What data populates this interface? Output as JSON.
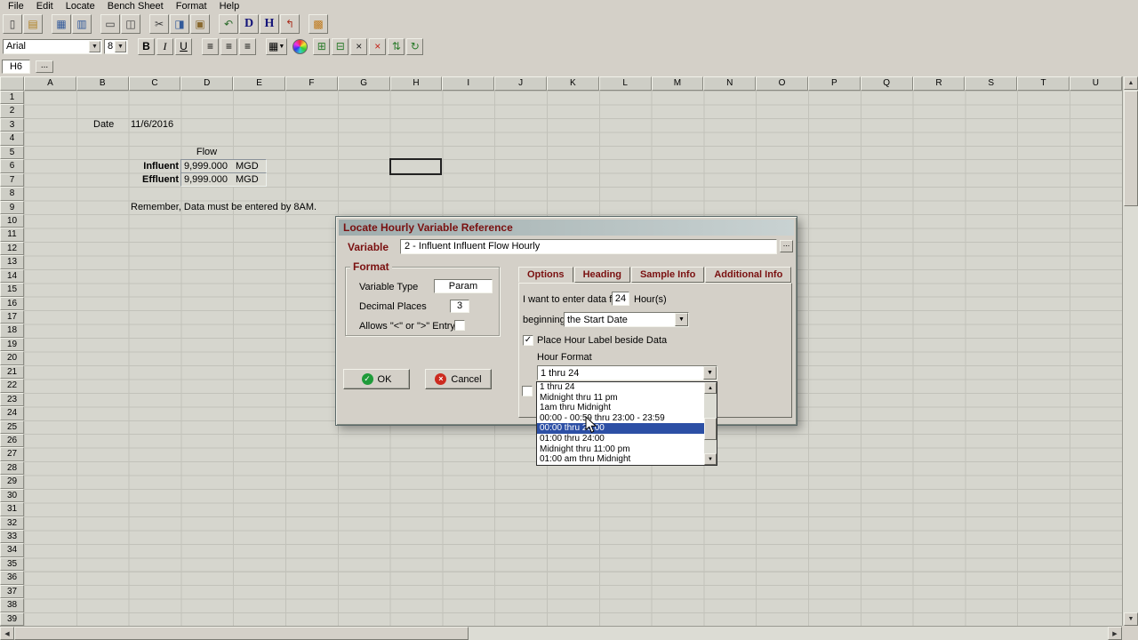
{
  "colors": {
    "accent_maroon": "#7a1010",
    "selection_blue": "#2c4fa5",
    "ok_green": "#1f9b3a",
    "cancel_red": "#cc2a1f",
    "window_gray": "#d4d0c8",
    "sheet_gray": "#d6d6ce"
  },
  "glyphs": {
    "check": "✓",
    "down_small": "▼",
    "up_small": "▲",
    "left_small": "◀",
    "right_small": "▶"
  },
  "menu": {
    "items": [
      {
        "label": "File",
        "name": "menu-file"
      },
      {
        "label": "Edit",
        "name": "menu-edit"
      },
      {
        "label": "Locate",
        "name": "menu-locate"
      },
      {
        "label": "Bench Sheet",
        "name": "menu-bench-sheet"
      },
      {
        "label": "Format",
        "name": "menu-format"
      },
      {
        "label": "Help",
        "name": "menu-help"
      }
    ]
  },
  "toolbar_icons": [
    {
      "name": "new-sheet-icon",
      "glyph": "▯",
      "color": "#404040"
    },
    {
      "name": "open-icon",
      "glyph": "▤",
      "color": "#b08020"
    },
    {
      "name": "save-icon",
      "glyph": "▦",
      "color": "#335a9a",
      "gap": true
    },
    {
      "name": "export-icon",
      "glyph": "▥",
      "color": "#335a9a"
    },
    {
      "name": "print-icon",
      "glyph": "▭",
      "color": "#404040",
      "gap": true
    },
    {
      "name": "print-preview-icon",
      "glyph": "◫",
      "color": "#404040"
    },
    {
      "name": "cut-icon",
      "glyph": "✂",
      "color": "#404040",
      "gap": true
    },
    {
      "name": "copy-icon",
      "glyph": "◨",
      "color": "#335a9a"
    },
    {
      "name": "paste-icon",
      "glyph": "▣",
      "color": "#8a6a30"
    },
    {
      "name": "undo-icon",
      "glyph": "↶",
      "color": "#2a6a2a",
      "gap": true
    },
    {
      "name": "daily-sheet-icon",
      "glyph": "D",
      "color": "#15157a",
      "bold": true
    },
    {
      "name": "hourly-sheet-icon",
      "glyph": "H",
      "color": "#15157a",
      "bold": true
    },
    {
      "name": "link-icon",
      "glyph": "↰",
      "color": "#aa3020"
    },
    {
      "name": "lock-icon",
      "glyph": "▩",
      "color": "#c07818",
      "gap": true
    }
  ],
  "toolbar2": {
    "font_name": "Arial",
    "font_size": "8",
    "bold": "B",
    "italic": "I",
    "underline": "U",
    "align_glyph": "≡",
    "borders_glyph": "▦"
  },
  "toolbar2_icons": [
    {
      "name": "merge-cells-icon",
      "glyph": "⊞",
      "color": "#2a7a2a"
    },
    {
      "name": "split-cells-icon",
      "glyph": "⊟",
      "color": "#2a7a2a"
    },
    {
      "name": "delete-icon",
      "glyph": "×",
      "color": "#202020"
    },
    {
      "name": "clear-icon",
      "glyph": "×",
      "color": "#c42218"
    },
    {
      "name": "sort-icon",
      "glyph": "⇅",
      "color": "#2a7a2a"
    },
    {
      "name": "recalc-icon",
      "glyph": "↻",
      "color": "#2a7a2a"
    }
  ],
  "formula_bar": {
    "cell_reference": "H6",
    "expand_label": "..."
  },
  "grid": {
    "columns": [
      "A",
      "B",
      "C",
      "D",
      "E",
      "F",
      "G",
      "H",
      "I",
      "J",
      "K",
      "L",
      "M",
      "N",
      "O",
      "P",
      "Q",
      "R",
      "S",
      "T",
      "U"
    ],
    "rows": [
      "1",
      "2",
      "3",
      "4",
      "5",
      "6",
      "7",
      "8",
      "9",
      "10",
      "11",
      "12",
      "13",
      "14",
      "15",
      "16",
      "17",
      "18",
      "19",
      "20",
      "21",
      "22",
      "23",
      "24",
      "25",
      "26",
      "27",
      "28",
      "29",
      "30",
      "31",
      "32",
      "33",
      "34",
      "35",
      "36",
      "37",
      "38",
      "39"
    ]
  },
  "sheet": {
    "date_label": "Date",
    "date_value": "11/6/2016",
    "flow_label": "Flow",
    "influent_label": "Influent",
    "influent_value": "9,999.000",
    "influent_unit": "MGD",
    "effluent_label": "Effluent",
    "effluent_value": "9,999.000",
    "effluent_unit": "MGD",
    "note": "Remember, Data must be entered by 8AM.",
    "selected_cell": "H6"
  },
  "dialog": {
    "title": "Locate Hourly Variable Reference",
    "variable_label": "Variable",
    "variable_value": "2 - Influent Influent Flow Hourly",
    "browse_label": "...",
    "format_group": {
      "title": "Format",
      "variable_type_label": "Variable Type",
      "variable_type_value": "Param",
      "decimal_places_label": "Decimal Places",
      "decimal_places_value": "3",
      "allows_label": "Allows \"<\" or \">\" Entry"
    },
    "tabs": [
      {
        "label": "Options",
        "name": "tab-options",
        "active": true
      },
      {
        "label": "Heading",
        "name": "tab-heading"
      },
      {
        "label": "Sample Info",
        "name": "tab-sample-info"
      },
      {
        "label": "Additional Info",
        "name": "tab-additional-info"
      }
    ],
    "options_tab": {
      "enter_data_label": "I want to enter data for",
      "hours_value": "24",
      "hours_suffix": "Hour(s)",
      "beginning_label": "beginning",
      "beginning_value": "the Start Date",
      "place_hour_label": "Place Hour Label beside Data",
      "place_hour_checked": true,
      "hour_format_label": "Hour Format",
      "hour_format": {
        "value": "1 thru 24",
        "selected_index": 4,
        "options": [
          "1 thru 24",
          "Midnight thru 11 pm",
          "1am thru Midnight",
          "00:00 - 00:59 thru 23:00 - 23:59",
          "00:00 thru 23:00",
          "01:00 thru 24:00",
          "Midnight thru 11:00 pm",
          "01:00 am thru Midnight"
        ]
      }
    },
    "ok_label": "OK",
    "cancel_label": "Cancel"
  }
}
